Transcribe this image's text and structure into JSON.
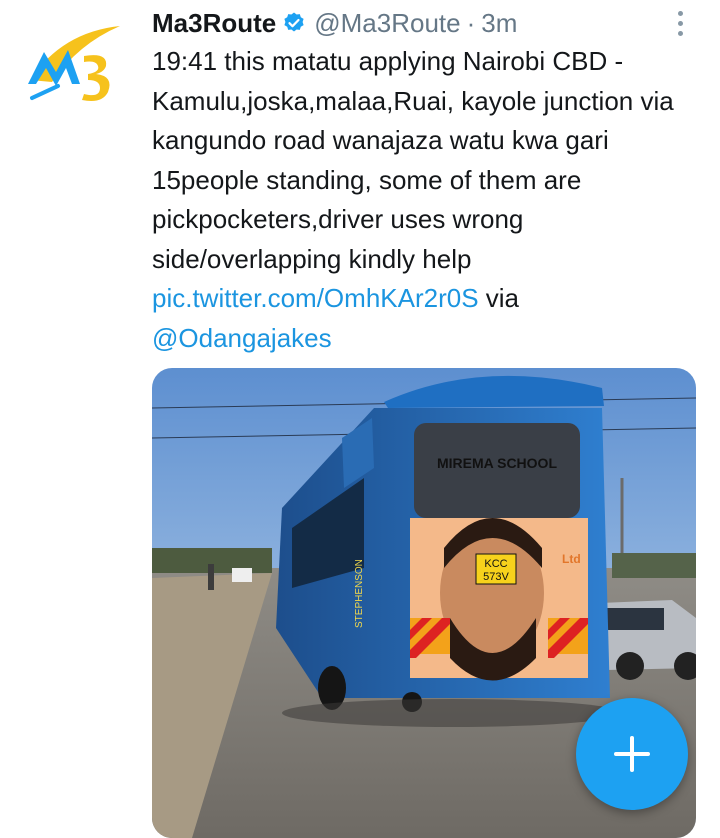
{
  "tweet": {
    "display_name": "Ma3Route",
    "handle": "@Ma3Route",
    "separator": "·",
    "time": "3m",
    "body_text": "19:41 this matatu applying Nairobi CBD - Kamulu,joska,malaa,Ruai, kayole junction via kangundo road wanajaza watu kwa gari 15people standing, some of them are pickpocketers,driver uses wrong side/overlapping kindly help ",
    "link": "pic.twitter.com/OmhKAr2r0S",
    "via": " via ",
    "mention": "@Odangajakes"
  },
  "photo": {
    "window_sign": "MIREMA SCHOOL",
    "plate_line1": "KCC",
    "plate_line2": "573V",
    "art_text": "Ltd",
    "side_text": "STEPHENSON"
  },
  "colors": {
    "link": "#1b95e0",
    "fab": "#1da1f2",
    "verified": "#1da1f2",
    "logo_blue": "#1da1f2",
    "logo_yellow": "#f6c21c"
  },
  "icons": {
    "verified": "verified-badge-icon",
    "more": "more-vertical-icon",
    "compose": "plus-icon"
  }
}
